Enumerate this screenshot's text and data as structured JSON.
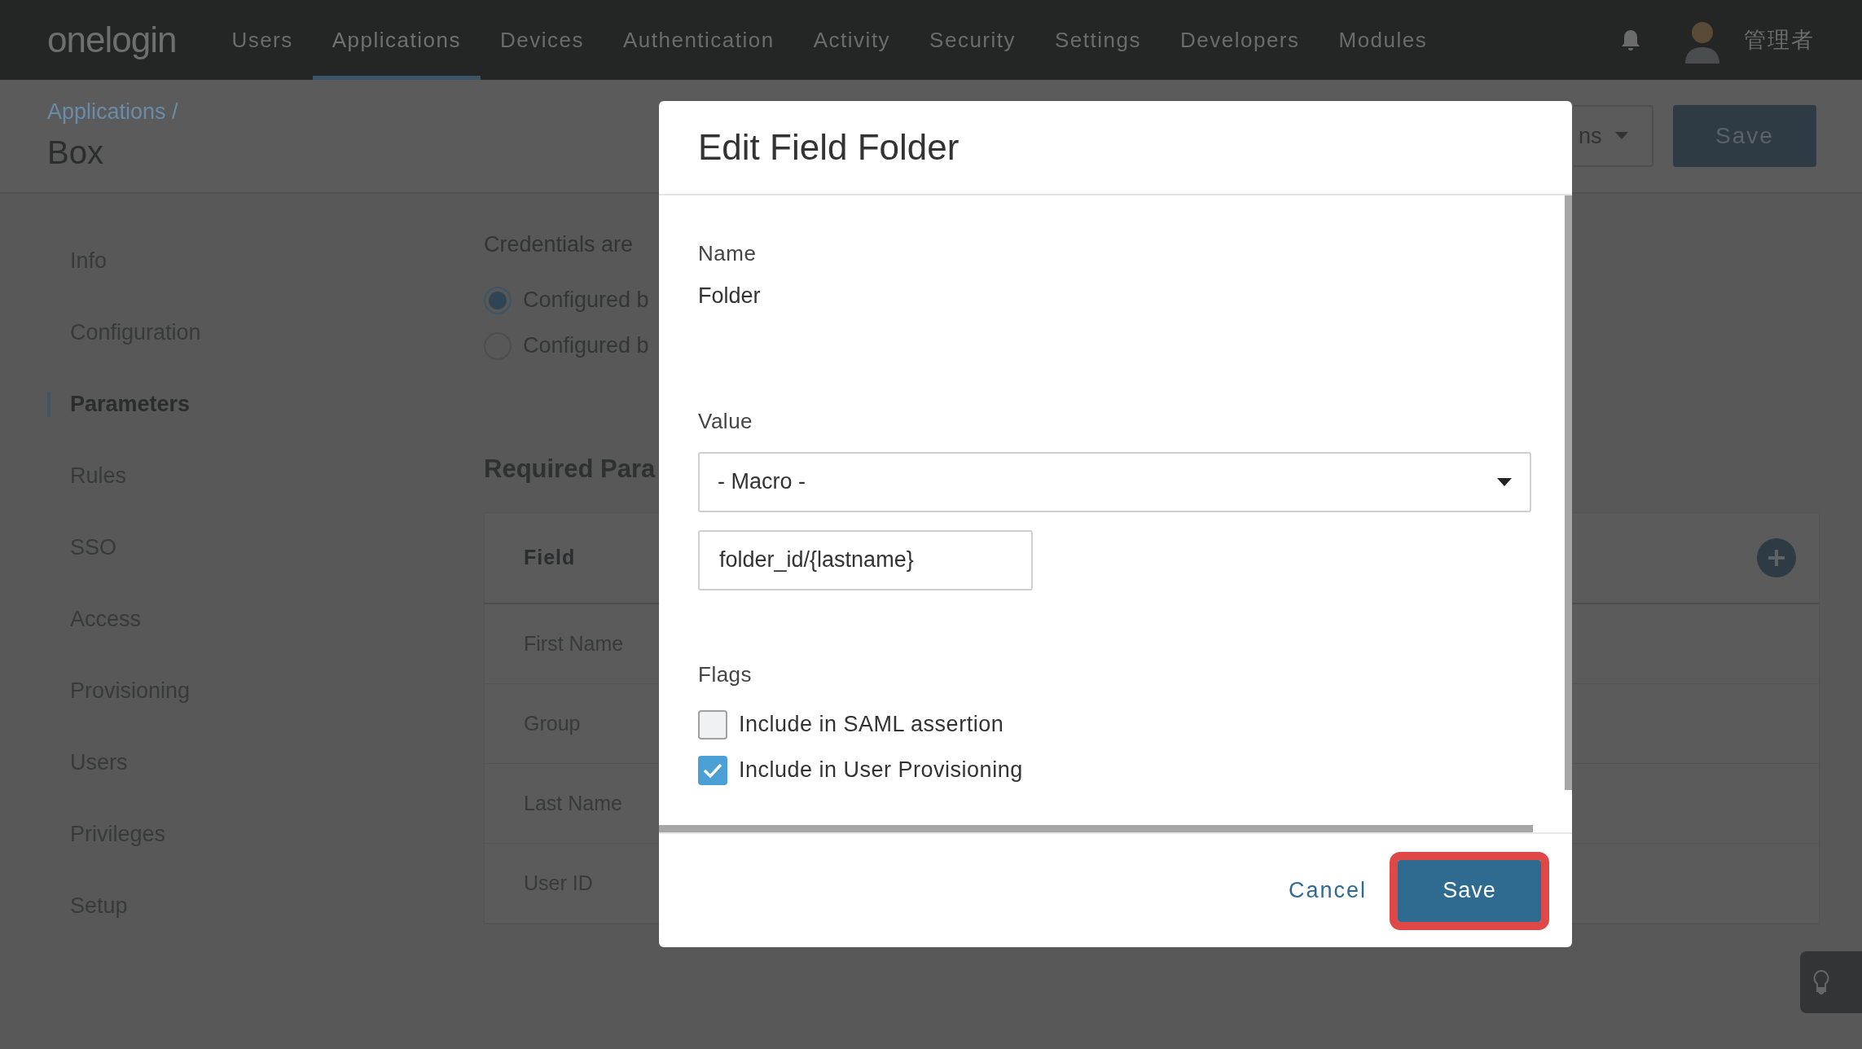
{
  "nav": {
    "logo": "onelogin",
    "user": "管理者",
    "items": [
      {
        "label": "Users",
        "selected": false
      },
      {
        "label": "Applications",
        "selected": true
      },
      {
        "label": "Devices",
        "selected": false
      },
      {
        "label": "Authentication",
        "selected": false
      },
      {
        "label": "Activity",
        "selected": false
      },
      {
        "label": "Security",
        "selected": false
      },
      {
        "label": "Settings",
        "selected": false
      },
      {
        "label": "Developers",
        "selected": false
      },
      {
        "label": "Modules",
        "selected": false
      }
    ]
  },
  "header": {
    "breadcrumb": "Applications /",
    "title": "Box",
    "more_button": "ns",
    "save_button": "Save"
  },
  "sidebar": {
    "items": [
      {
        "label": "Info",
        "selected": false
      },
      {
        "label": "Configuration",
        "selected": false
      },
      {
        "label": "Parameters",
        "selected": true
      },
      {
        "label": "Rules",
        "selected": false
      },
      {
        "label": "SSO",
        "selected": false
      },
      {
        "label": "Access",
        "selected": false
      },
      {
        "label": "Provisioning",
        "selected": false
      },
      {
        "label": "Users",
        "selected": false
      },
      {
        "label": "Privileges",
        "selected": false
      },
      {
        "label": "Setup",
        "selected": false
      }
    ]
  },
  "content": {
    "credentials_label": "Credentials are",
    "radios": [
      {
        "label": "Configured b",
        "selected": true
      },
      {
        "label": "Configured b",
        "selected": false
      }
    ],
    "section_title": "Required Para",
    "table": {
      "columns": [
        "Field"
      ],
      "rows": [
        {
          "cells": [
            "First Name"
          ]
        },
        {
          "cells": [
            "Group"
          ]
        },
        {
          "cells": [
            "Last Name"
          ]
        },
        {
          "cells": [
            "User ID"
          ]
        }
      ]
    }
  },
  "modal": {
    "title": "Edit Field Folder",
    "name_label": "Name",
    "name_value": "Folder",
    "value_label": "Value",
    "value_select": "- Macro -",
    "value_input": "folder_id/{lastname}",
    "flags_label": "Flags",
    "flags": [
      {
        "label": "Include in SAML assertion",
        "checked": false
      },
      {
        "label": "Include in User Provisioning",
        "checked": true
      }
    ],
    "cancel": "Cancel",
    "save": {
      "label": "Save",
      "highlighted": true
    }
  }
}
